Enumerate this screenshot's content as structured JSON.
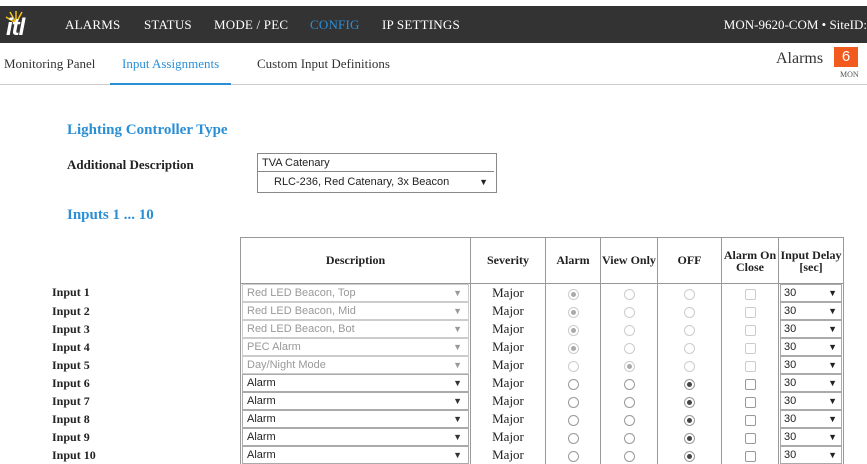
{
  "nav": {
    "items": [
      "ALARMS",
      "STATUS",
      "MODE / PEC",
      "CONFIG",
      "IP SETTINGS"
    ],
    "active": "CONFIG",
    "site": "MON-9620-COM • SiteID:"
  },
  "subnav": {
    "items": [
      "Monitoring Panel",
      "Input Assignments",
      "Custom Input Definitions"
    ],
    "active": "Input Assignments"
  },
  "alarms": {
    "label": "Alarms",
    "count": "6",
    "sub": "MON"
  },
  "lighting": {
    "title": "Lighting Controller Type",
    "desc_label": "Additional Description",
    "desc_value": "TVA Catenary",
    "type_value": "RLC-236, Red Catenary, 3x Beacon"
  },
  "inputs": {
    "title": "Inputs 1 ... 10",
    "headers": {
      "description": "Description",
      "severity": "Severity",
      "alarm": "Alarm",
      "view_only": "View Only",
      "off": "OFF",
      "alarm_on_close": "Alarm On Close",
      "input_delay": "Input Delay [sec]"
    },
    "rows": [
      {
        "label": "Input 1",
        "description": "Red LED Beacon, Top",
        "severity": "Major",
        "mode": "alarm",
        "locked": true,
        "delay": "30"
      },
      {
        "label": "Input 2",
        "description": "Red LED Beacon, Mid",
        "severity": "Major",
        "mode": "alarm",
        "locked": true,
        "delay": "30"
      },
      {
        "label": "Input 3",
        "description": "Red LED Beacon, Bot",
        "severity": "Major",
        "mode": "alarm",
        "locked": true,
        "delay": "30"
      },
      {
        "label": "Input 4",
        "description": "PEC Alarm",
        "severity": "Major",
        "mode": "alarm",
        "locked": true,
        "delay": "30"
      },
      {
        "label": "Input 5",
        "description": "Day/Night Mode",
        "severity": "Major",
        "mode": "view",
        "locked": true,
        "delay": "30"
      },
      {
        "label": "Input 6",
        "description": "Alarm",
        "severity": "Major",
        "mode": "off",
        "locked": false,
        "delay": "30"
      },
      {
        "label": "Input 7",
        "description": "Alarm",
        "severity": "Major",
        "mode": "off",
        "locked": false,
        "delay": "30"
      },
      {
        "label": "Input 8",
        "description": "Alarm",
        "severity": "Major",
        "mode": "off",
        "locked": false,
        "delay": "30"
      },
      {
        "label": "Input 9",
        "description": "Alarm",
        "severity": "Major",
        "mode": "off",
        "locked": false,
        "delay": "30"
      },
      {
        "label": "Input 10",
        "description": "Alarm",
        "severity": "Major",
        "mode": "off",
        "locked": false,
        "delay": "30"
      }
    ]
  }
}
